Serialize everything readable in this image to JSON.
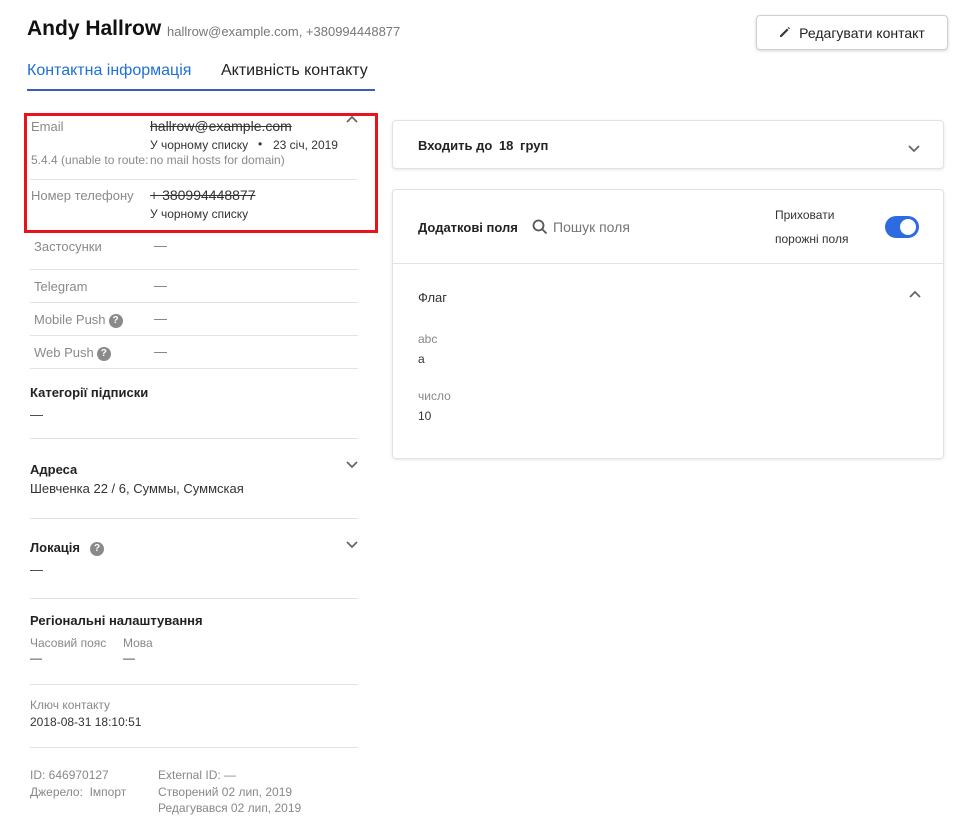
{
  "header": {
    "name": "Andy Hallrow",
    "subtitle": "hallrow@example.com, +380994448877",
    "edit_button": "Редагувати контакт"
  },
  "tabs": [
    {
      "label": "Контактна інформація",
      "active": true
    },
    {
      "label": "Активність контакту",
      "active": false
    }
  ],
  "channels": {
    "email": {
      "label": "Email",
      "value": "hallrow@example.com",
      "status": "У чорному списку",
      "separator": "•",
      "date": "23 січ, 2019",
      "error_prefix": "5.4.4 (unable to route:",
      "error_suffix": "no mail hosts for domain)"
    },
    "phone": {
      "label": "Номер телефону",
      "value": "+ 380994448877",
      "status": "У чорному списку"
    },
    "apps": {
      "label": "Застосунки",
      "value": "—"
    },
    "telegram": {
      "label": "Telegram",
      "value": "—"
    },
    "mobile_push": {
      "label": "Mobile Push",
      "value": "—"
    },
    "web_push": {
      "label": "Web Push",
      "value": "—"
    }
  },
  "subscriptions": {
    "title": "Категорії підписки",
    "value": "—"
  },
  "address": {
    "title": "Адреса",
    "value": "Шевченка 22 / 6, Суммы, Суммская"
  },
  "location": {
    "title": "Локація",
    "value": "—"
  },
  "regional": {
    "title": "Регіональні налаштування",
    "timezone_label": "Часовий пояс",
    "timezone_value": "—",
    "language_label": "Мова",
    "language_value": "—"
  },
  "contact_key": {
    "label": "Ключ контакту",
    "value": "2018-08-31 18:10:51"
  },
  "footer": {
    "id": "ID: 646970127",
    "source": "Джерело:  Імпорт",
    "external_id": "External ID: —",
    "created": "Створений 02 лип, 2019",
    "edited": "Редагувався 02 лип, 2019"
  },
  "groups": {
    "prefix": "Входить до",
    "count": "18",
    "suffix": "груп"
  },
  "extra_fields": {
    "title": "Додаткові поля",
    "search_placeholder": "Пошук поля",
    "hide_empty_line1": "Приховати",
    "hide_empty_line2": "порожні поля",
    "hide_empty_enabled": true,
    "flag_title": "Флаг",
    "fields": [
      {
        "label": "abc",
        "value": "a"
      },
      {
        "label": "число",
        "value": "10"
      }
    ]
  },
  "help_icon_glyph": "?",
  "colors": {
    "accent": "#1e6fd9",
    "toggle": "#2f6be0",
    "highlight_box": "#e8131b"
  }
}
